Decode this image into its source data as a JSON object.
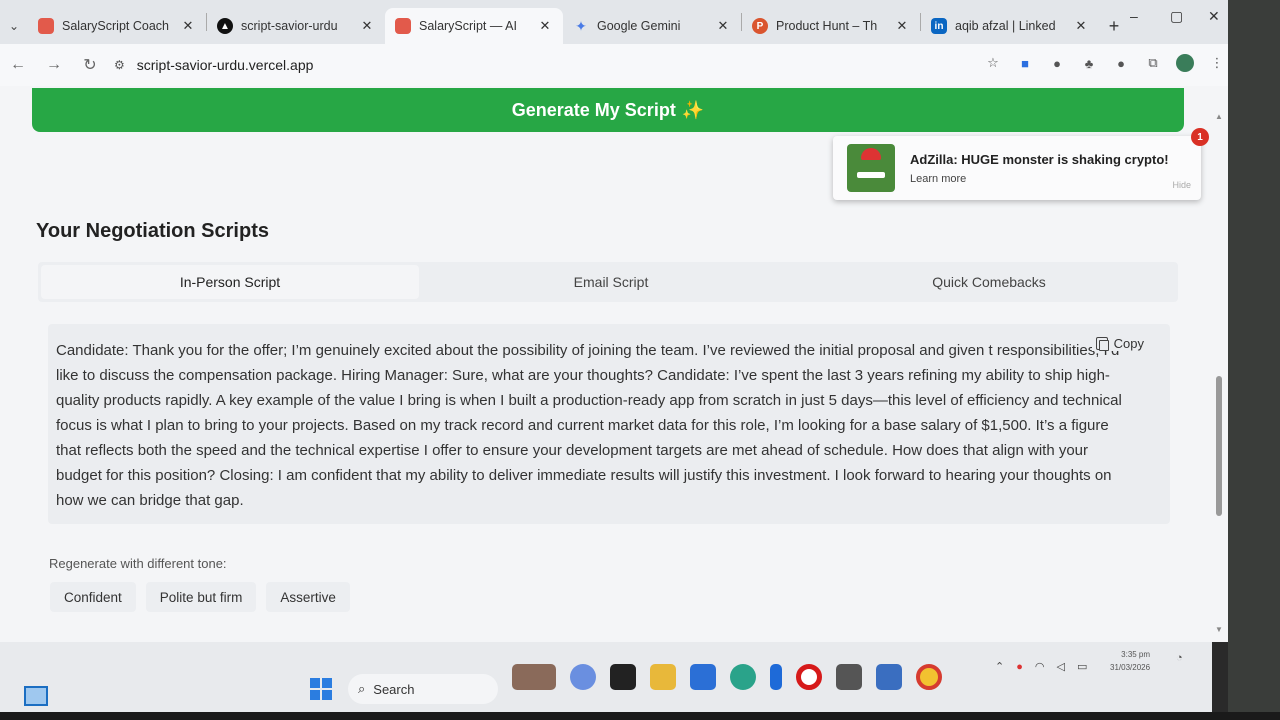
{
  "browser": {
    "tabs": [
      {
        "title": "SalaryScript Coach",
        "fav_color": "#e25a4b"
      },
      {
        "title": "script-savior-urdu",
        "fav_color": "#111111"
      },
      {
        "title": "SalaryScript — AI",
        "fav_color": "#e25a4b"
      },
      {
        "title": "Google Gemini",
        "fav_color": "#4a7be6"
      },
      {
        "title": "Product Hunt – Th",
        "fav_color": "#da552f"
      },
      {
        "title": "aqib afzal | Linked",
        "fav_color": "#0a66c2"
      }
    ],
    "url": "script-savior-urdu.vercel.app"
  },
  "page": {
    "generate_label": "Generate My Script",
    "generate_spark": "✨",
    "section_title": "Your Negotiation Scripts",
    "tabs": [
      {
        "label": "In-Person Script"
      },
      {
        "label": "Email Script"
      },
      {
        "label": "Quick Comebacks"
      }
    ],
    "copy_label": "Copy",
    "script_text": "Candidate: Thank you for the offer; I’m genuinely excited about the possibility of joining the team. I’ve reviewed the initial proposal and given t responsibilities, I’d like to discuss the compensation package. Hiring Manager: Sure, what are your thoughts? Candidate: I’ve spent the last 3 years refining my ability to ship high-quality products rapidly. A key example of the value I bring is when I built a production-ready app from scratch in just 5 days—this level of efficiency and technical focus is what I plan to bring to your projects. Based on my track record and current market data for this role, I’m looking for a base salary of $1,500. It’s a figure that reflects both the speed and the technical expertise I offer to ensure your development targets are met ahead of schedule. How does that align with your budget for this position? Closing: I am confident that my ability to deliver immediate results will justify this investment. I look forward to hearing your thoughts on how we can bridge that gap.",
    "regen_label": "Regenerate with different tone:",
    "tones": [
      "Confident",
      "Polite but firm",
      "Assertive"
    ]
  },
  "notification": {
    "title": "AdZilla: HUGE monster is shaking crypto!",
    "link": "Learn more",
    "hide": "Hide",
    "badge": "1"
  },
  "taskbar": {
    "search_label": "Search",
    "time": "3:35 pm",
    "date": "31/03/2026"
  }
}
